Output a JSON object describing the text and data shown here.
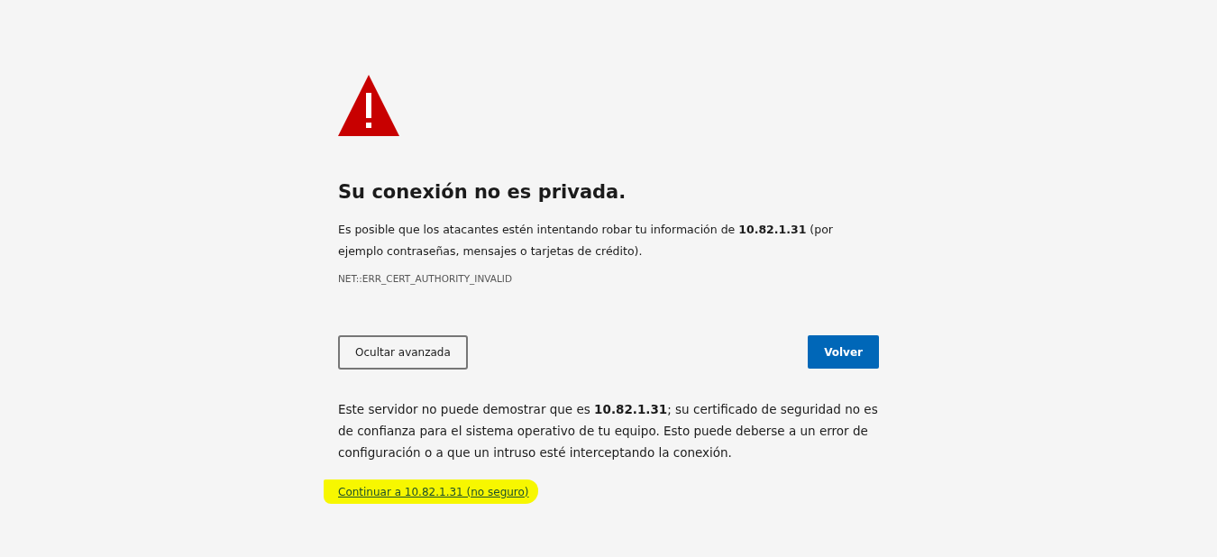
{
  "heading": "Su conexión no es privada.",
  "message": "Es posible que los atacantes estén intentando robar tu información de **10.82.1.31** (por ejemplo contraseñas, mensajes o tarjetas de crédito).",
  "error_code": "NET::ERR_CERT_AUTHORITY_INVALID",
  "buttons": [
    {
      "label": "Ocultar avanzada",
      "kind": "secondary"
    },
    {
      "label": "Volver",
      "kind": "primary"
    }
  ],
  "details": "Este servidor no puede demostrar que es **10.82.1.31**; su certificado de seguridad no es de confianza para el sistema operativo de tu equipo. Esto puede deberse a un error de configuración o a que un intruso esté interceptando la conexión.",
  "proceed_link": "Continuar a 10.82.1.31 (no seguro)"
}
